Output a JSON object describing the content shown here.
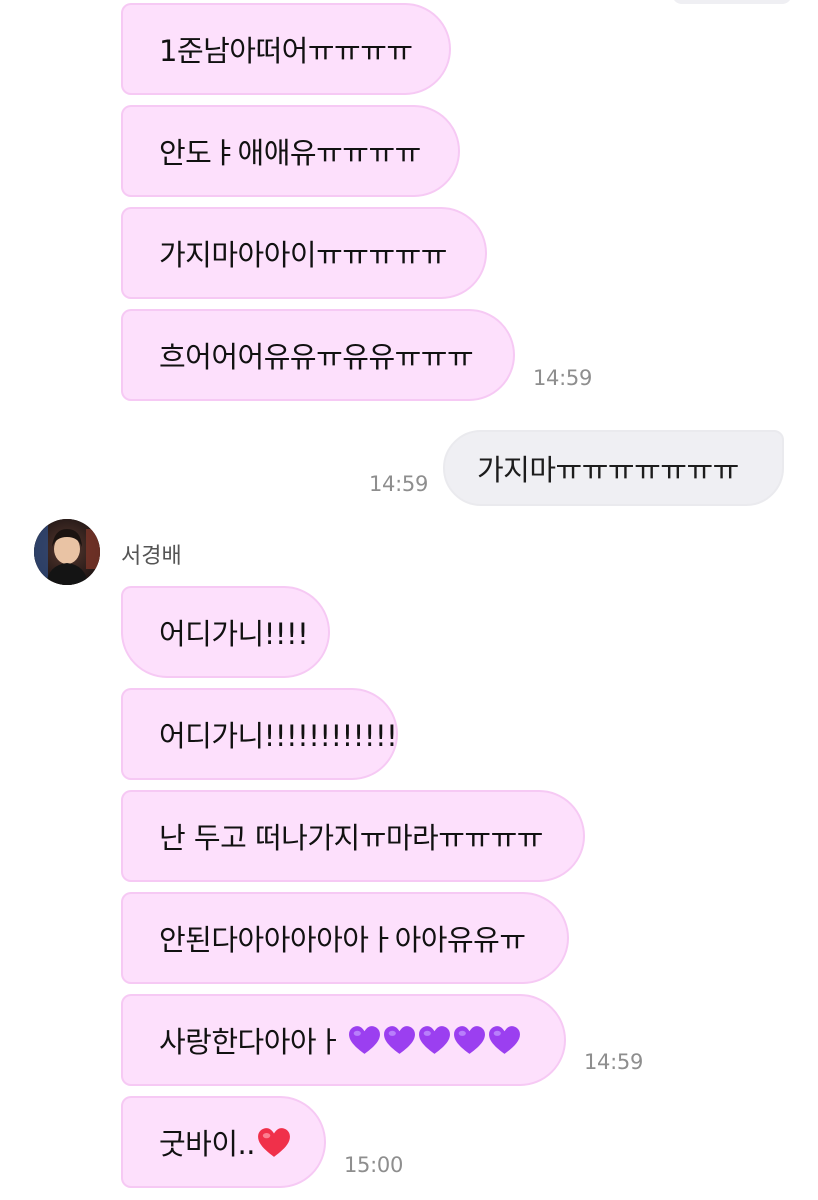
{
  "chat": {
    "sender_name": "서경배",
    "messages_block1": [
      "1준남아떠어ㅠㅠㅠㅠ",
      "안도ㅑ애애유ㅠㅠㅠㅠ",
      "가지마아아이ㅠㅠㅠㅠㅠ",
      "흐어어어유유ㅠ유유ㅠㅠㅠ"
    ],
    "time_block1": "14:59",
    "outgoing_message": "가지마ㅠㅠㅠㅠㅠㅠㅠ",
    "time_outgoing": "14:59",
    "messages_block2": [
      "어디가니!!!!",
      "어디가니!!!!!!!!!!!!",
      "난 두고 떠나가지ㅠ마라ㅠㅠㅠㅠ",
      "안된다아아아아아ㅏ아아유유ㅠ",
      "사랑한다아아ㅏ"
    ],
    "time_block2": "14:59",
    "last_message": "굿바이..",
    "time_last": "15:00",
    "purple_hearts": 5,
    "colors": {
      "incoming_bubble": "#fde0fc",
      "outgoing_bubble": "#efeff3",
      "timestamp": "#8e8e8e",
      "purple_heart": "#9b3ff0",
      "red_heart": "#f0304a"
    },
    "icons": [
      "purple-heart-emoji",
      "red-heart-emoji"
    ]
  }
}
